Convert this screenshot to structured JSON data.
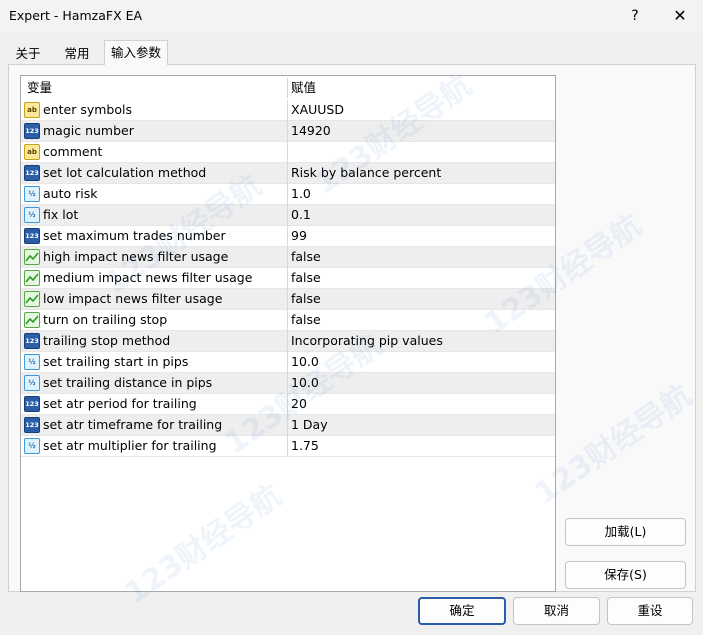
{
  "window": {
    "title": "Expert - HamzaFX EA",
    "help_symbol": "?",
    "close_symbol": "✕"
  },
  "tabs": [
    {
      "label": "关于",
      "active": false
    },
    {
      "label": "常用",
      "active": false
    },
    {
      "label": "输入参数",
      "active": true
    }
  ],
  "grid": {
    "col_variable": "变量",
    "col_value": "赋值",
    "rows": [
      {
        "icon": "ab-icon",
        "icon_text": "ab",
        "name": "enter symbols",
        "value": "XAUUSD"
      },
      {
        "icon": "123-icon",
        "icon_text": "123",
        "name": "magic number",
        "value": "14920"
      },
      {
        "icon": "ab-icon",
        "icon_text": "ab",
        "name": "comment",
        "value": ""
      },
      {
        "icon": "123-icon",
        "icon_text": "123",
        "name": "set lot calculation method",
        "value": "Risk by balance percent"
      },
      {
        "icon": "fraction-icon",
        "icon_text": "½",
        "name": "auto risk",
        "value": "1.0"
      },
      {
        "icon": "fraction-icon",
        "icon_text": "½",
        "name": "fix lot",
        "value": "0.1"
      },
      {
        "icon": "123-icon",
        "icon_text": "123",
        "name": "set maximum trades number",
        "value": "99"
      },
      {
        "icon": "bool-icon",
        "icon_text": "",
        "name": "high impact news filter usage",
        "value": "false"
      },
      {
        "icon": "bool-icon",
        "icon_text": "",
        "name": "medium impact news filter usage",
        "value": "false"
      },
      {
        "icon": "bool-icon",
        "icon_text": "",
        "name": "low impact news filter usage",
        "value": "false"
      },
      {
        "icon": "bool-icon",
        "icon_text": "",
        "name": "turn on trailing stop",
        "value": "false"
      },
      {
        "icon": "123-icon",
        "icon_text": "123",
        "name": "trailing stop method",
        "value": "Incorporating pip values"
      },
      {
        "icon": "fraction-icon",
        "icon_text": "½",
        "name": "set trailing start in pips",
        "value": "10.0"
      },
      {
        "icon": "fraction-icon",
        "icon_text": "½",
        "name": "set trailing distance in pips",
        "value": "10.0"
      },
      {
        "icon": "123-icon",
        "icon_text": "123",
        "name": "set atr period for trailing",
        "value": "20"
      },
      {
        "icon": "123-icon",
        "icon_text": "123",
        "name": "set atr timeframe for trailing",
        "value": "1 Day"
      },
      {
        "icon": "fraction-icon",
        "icon_text": "½",
        "name": "set atr multiplier for trailing",
        "value": "1.75"
      }
    ]
  },
  "side_buttons": {
    "load": "加载(L)",
    "save": "保存(S)"
  },
  "footer_buttons": {
    "ok": "确定",
    "cancel": "取消",
    "reset": "重设"
  },
  "watermark_text": "123财经导航",
  "colors": {
    "accent": "#2a5ea8",
    "row_alt": "#eeeeee",
    "bool_icon_green": "#2f9a2a"
  }
}
